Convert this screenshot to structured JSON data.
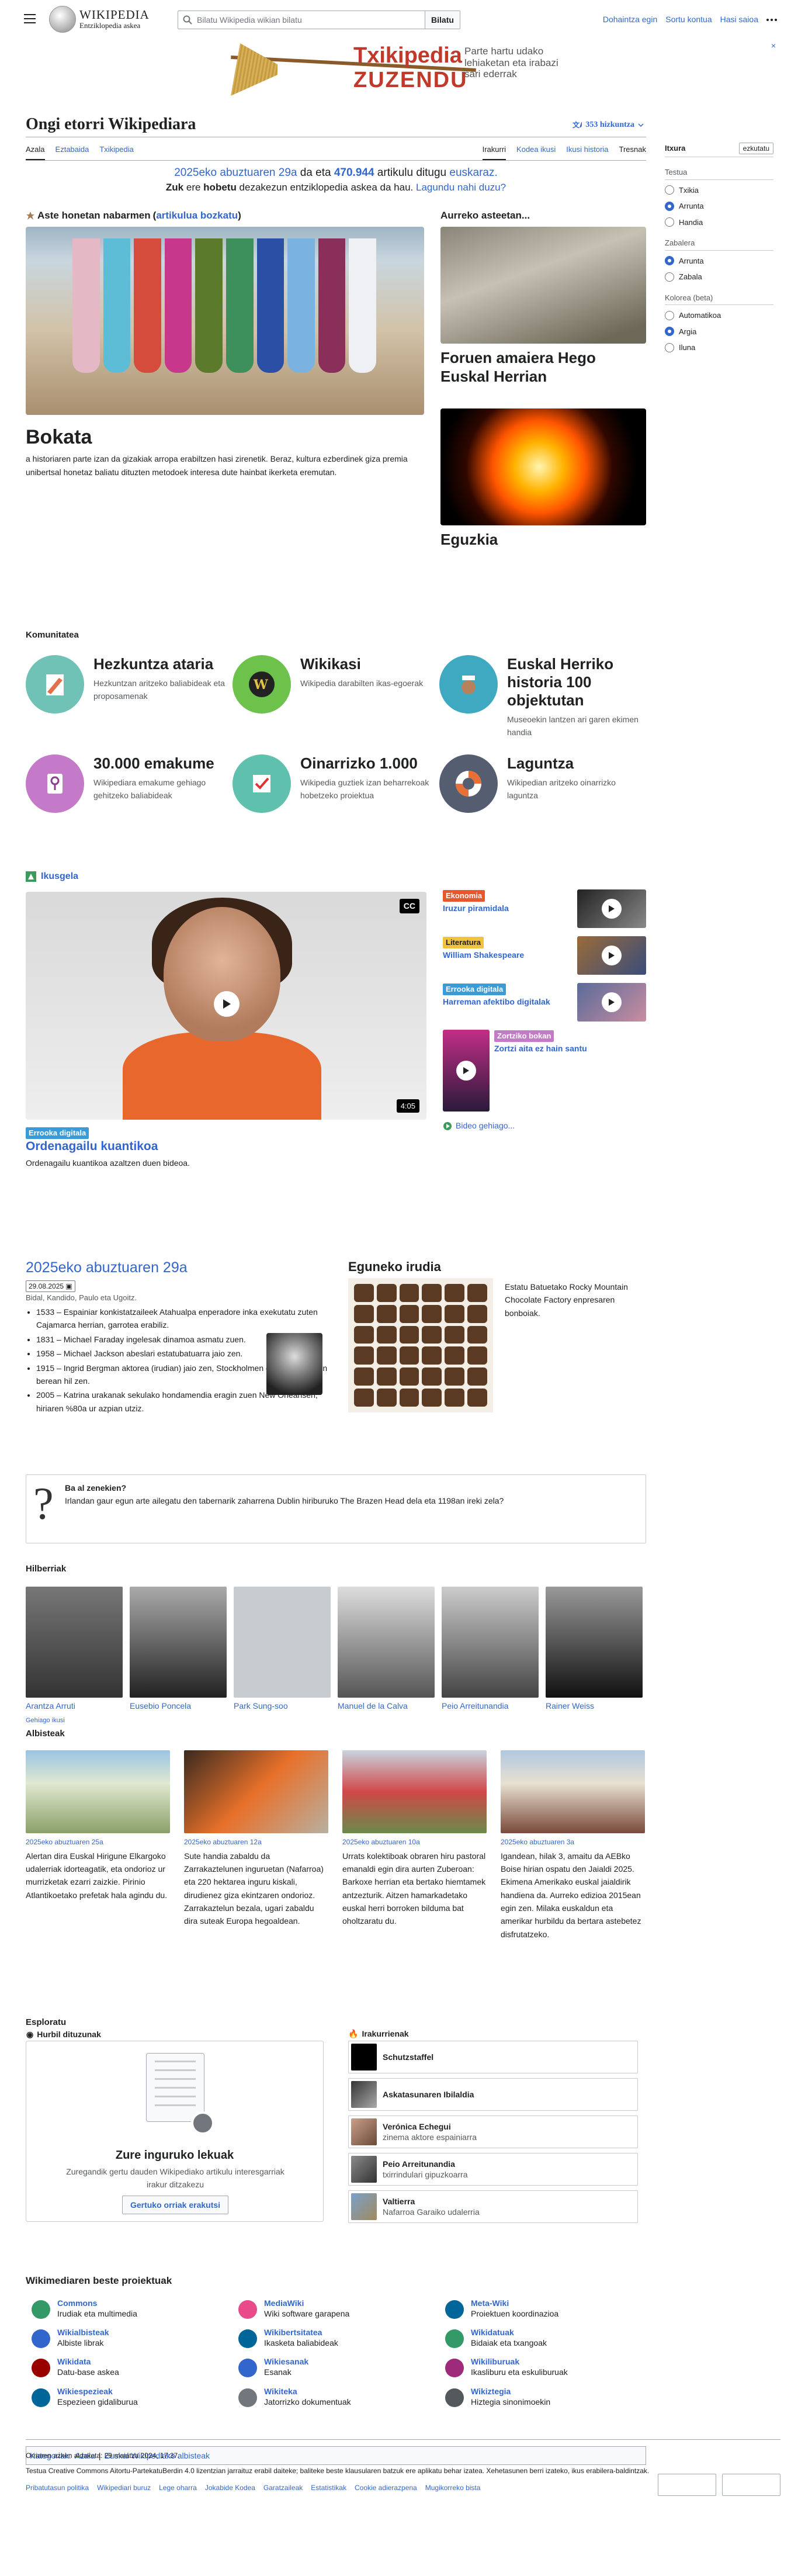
{
  "header": {
    "wordmark": "WIKIPEDIA",
    "tagline": "Entziklopedia askea",
    "search_placeholder": "Bilatu Wikipedia wikian bilatu",
    "search_button": "Bilatu",
    "user_links": [
      "Dohaintza egin",
      "Sortu kontua",
      "Hasi saioa"
    ]
  },
  "banner": {
    "line1": "Txikipedia",
    "line2": "ZUZENDU",
    "tagline": "Parte hartu udako lehiaketan eta irabazi sari ederrak",
    "close": "×"
  },
  "page": {
    "title": "Ongi etorri Wikipediara",
    "languages": "353 hizkuntza",
    "tabs_left": [
      "Azala",
      "Eztabaida",
      "Txikipedia"
    ],
    "tabs_right": [
      "Irakurri",
      "Kodea ikusi",
      "Ikusi historia",
      "Tresnak"
    ],
    "welcome_date": "2025eko abuztuaren 29a",
    "welcome_mid1": " da eta ",
    "welcome_count": "470.944",
    "welcome_mid2": " artikulu ditugu ",
    "welcome_lang": "euskaraz.",
    "sub_a": "Zuk",
    "sub_b": " ere ",
    "sub_c": "hobetu",
    "sub_d": " dezakezun entziklopedia askea da hau. ",
    "sub_e": "Lagundu nahi duzu?"
  },
  "tools": {
    "title": "Itxura",
    "hide": "ezkutatu",
    "text_label": "Testua",
    "text_opts": [
      "Txikia",
      "Arrunta",
      "Handia"
    ],
    "width_label": "Zabalera",
    "width_opts": [
      "Arrunta",
      "Zabala"
    ],
    "color_label": "Kolorea (beta)",
    "color_opts": [
      "Automatikoa",
      "Argia",
      "Iluna"
    ]
  },
  "featured": {
    "heading": "Aste honetan nabarmen",
    "heading_link": "artikulua bozkatu",
    "title": "Bokata",
    "text": "a historiaren parte izan da gizakiak arropa erabiltzen hasi zirenetik. Beraz, kultura ezberdinek giza premia unibertsal honetaz baliatu dituzten metodoek interesa dute hainbat ikerketa eremutan."
  },
  "didyou": {
    "heading": "Aurreko asteetan...",
    "item1": "Foruen amaiera Hego Euskal Herrian",
    "item2": "Eguzkia"
  },
  "community": {
    "heading": "Komunitatea",
    "items": [
      {
        "title": "Hezkuntza ataria",
        "text": "Hezkuntzan aritzeko baliabideak eta proposamenak"
      },
      {
        "title": "Wikikasi",
        "text": "Wikipedia darabilten ikas-egoerak"
      },
      {
        "title": "Euskal Herriko historia 100 objektutan",
        "text": "Museoekin lantzen ari garen ekimen handia"
      },
      {
        "title": "30.000 emakume",
        "text": "Wikipediara emakume gehiago gehitzeko baliabideak"
      },
      {
        "title": "Oinarrizko 1.000",
        "text": "Wikipedia guztiek izan beharrekoak hobetzeko proiektua"
      },
      {
        "title": "Laguntza",
        "text": "Wikipedian aritzeko oinarrizko laguntza"
      }
    ]
  },
  "media": {
    "heading": "Ikusgela",
    "cc": "CC",
    "duration": "4:05",
    "main_tag": "Errooka digitala",
    "main_title": "Ordenagailu kuantikoa",
    "main_text": "Ordenagailu kuantikoa azaltzen duen bideoa.",
    "side": [
      {
        "tag": "Ekonomia",
        "title": "Iruzur piramidala"
      },
      {
        "tag": "Literatura",
        "title": "William Shakespeare"
      },
      {
        "tag": "Errooka digitala",
        "title": "Harreman afektibo digitalak"
      },
      {
        "tag": "Zortziko bokan",
        "title": "Zortzi aita ez hain santu"
      }
    ],
    "more": "Bideo gehiago..."
  },
  "otd": {
    "title": "2025eko abuztuaren 29a",
    "date": "29.08.2025",
    "saints": "Bidal, Kandido, Paulo eta Ugoitz.",
    "events": [
      "1533 – Espainiar konkistatzaileek Atahualpa enperadore inka exekutatu zuten Cajamarca herrian, garrotea erabiliz.",
      "1831 – Michael Faraday ingelesak dinamoa asmatu zuen.",
      "1958 – Michael Jackson abeslari estatubatuarra jaio zen.",
      "1915 – Ingrid Bergman aktorea (irudian) jaio zen, Stockholmen eta 1982an egun berean hil zen.",
      "2005 – Katrina urakanak sekulako hondamendia eragin zuen New Orleansen, hiriaren %80a ur azpian utziz."
    ]
  },
  "potd": {
    "title": "Eguneko irudia",
    "caption": "Estatu Batuetako Rocky Mountain Chocolate Factory enpresaren bonboiak."
  },
  "dyk": {
    "title": "Ba al zenekien?",
    "text": "Irlandan gaur egun arte ailegatu den tabernarik zaharrena Dublin hiriburuko The Brazen Head dela eta 1198an ireki zela?"
  },
  "died": {
    "heading": "Hilberriak",
    "people": [
      "Arantza Arruti",
      "Eusebio Poncela",
      "Park Sung-soo",
      "Manuel de la Calva",
      "Peio Arreitunandia",
      "Rainer Weiss"
    ],
    "more": "Gehiago ikusi"
  },
  "news": {
    "heading": "Albisteak",
    "items": [
      {
        "date": "2025eko abuztuaren 25a",
        "text": "Alertan dira Euskal Hirigune Elkargoko udalerriak idorteagatik, eta ondorioz ur murrizketak ezarri zaizkie. Pirinio Atlantikoetako prefetak hala agindu du."
      },
      {
        "date": "2025eko abuztuaren 12a",
        "text": "Sute handia zabaldu da Zarrakaztelunen inguruetan (Nafarroa) eta 220 hektarea inguru kiskali, dirudienez giza ekintzaren ondorioz. Zarrakaztelun bezala, ugari zabaldu dira suteak Europa hegoaldean."
      },
      {
        "date": "2025eko abuztuaren 10a",
        "text": "Urrats kolektiboak obraren hiru pastoral emanaldi egin dira aurten Zuberoan: Barkoxe herrian eta bertako hiemtamek antzezturik. Aitzen hamarkadetako euskal herri borroken bilduma bat oholtzaratu du."
      },
      {
        "date": "2025eko abuztuaren 3a",
        "text": "Igandean, hilak 3, amaitu da AEBko Boise hirian ospatu den Jaialdi 2025. Ekimena Amerikako euskal jaialdirik handiena da. Aurreko edizioa 2015ean egin zen. Milaka euskaldun eta amerikar hurbildu da bertara astebetez disfrutatzeko."
      }
    ]
  },
  "explore": {
    "heading": "Esploratu",
    "near_heading": "Hurbil dituzunak",
    "near_title": "Zure inguruko lekuak",
    "near_text": "Zuregandik gertu dauden Wikipediako artikulu interesgarriak irakur ditzakezu",
    "near_button": "Gertuko orriak erakutsi",
    "trend_heading": "Irakurrienak",
    "trending": [
      {
        "title": "Schutzstaffel",
        "sub": ""
      },
      {
        "title": "Askatasunaren Ibilaldia",
        "sub": ""
      },
      {
        "title": "Verónica Echegui",
        "sub": "zinema aktore espainiarra"
      },
      {
        "title": "Peio Arreitunandia",
        "sub": "txirrindulari gipuzkoarra"
      },
      {
        "title": "Valtierra",
        "sub": "Nafarroa Garaiko udalerria"
      }
    ]
  },
  "sister": {
    "heading": "Wikimediaren beste proiektuak",
    "items": [
      {
        "name": "Commons",
        "desc": "Irudiak eta multimedia",
        "color": "#339966"
      },
      {
        "name": "MediaWiki",
        "desc": "Wiki software garapena",
        "color": "#e84a8a"
      },
      {
        "name": "Meta-Wiki",
        "desc": "Proiektuen koordinazioa",
        "color": "#006699"
      },
      {
        "name": "Wikialbisteak",
        "desc": "Albiste librak",
        "color": "#3366cc"
      },
      {
        "name": "Wikibertsitatea",
        "desc": "Ikasketa baliabideak",
        "color": "#006699"
      },
      {
        "name": "Wikidatuak",
        "desc": "Bidaiak eta txangoak",
        "color": "#339966"
      },
      {
        "name": "Wikidata",
        "desc": "Datu-base askea",
        "color": "#990000"
      },
      {
        "name": "Wikiesanak",
        "desc": "Esanak",
        "color": "#36c"
      },
      {
        "name": "Wikiliburuak",
        "desc": "Ikasliburu eta eskuliburuak",
        "color": "#9e2a7b"
      },
      {
        "name": "Wikiespezieak",
        "desc": "Espezieen gidaliburua",
        "color": "#006699"
      },
      {
        "name": "Wikiteka",
        "desc": "Jatorrizko dokumentuak",
        "color": "#72777d"
      },
      {
        "name": "Wikiztegia",
        "desc": "Hiztegia sinonimoekin",
        "color": "#54595d"
      }
    ]
  },
  "categories": {
    "label": "Kategoriak:",
    "items": [
      "Azala",
      "Euskal Wikipediako albisteak"
    ]
  },
  "footer": {
    "edited": "Orriaren azken aldaketa: 29 maiatza 2024, 17:37.",
    "license": "Testua Creative Commons Aitortu-PartekatuBerdin 4.0 lizentzian jarraituz erabil daiteke; baliteke beste klausularen batzuk ere aplikatu behar izatea. Xehetasunen berri izateko, ikus erabilera-baldintzak.",
    "links": [
      "Pribatutasun politika",
      "Wikipediari buruz",
      "Lege oharra",
      "Jokabide Kodea",
      "Garatzaileak",
      "Estatistikak",
      "Cookie adierazpena",
      "Mugikorreko bista"
    ]
  }
}
